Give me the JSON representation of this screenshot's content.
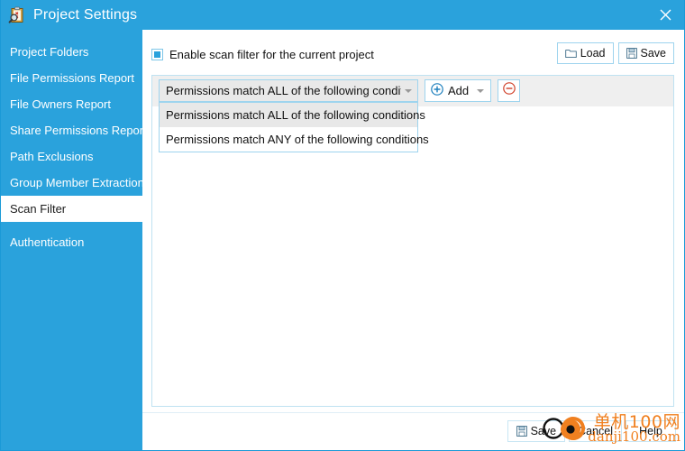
{
  "window": {
    "title": "Project Settings",
    "icon": "clipboard-search-icon",
    "close_label": "×",
    "accent_color": "#2aa2dc"
  },
  "sidebar": {
    "items": [
      {
        "label": "Project Folders",
        "selected": false
      },
      {
        "label": "File Permissions Report",
        "selected": false
      },
      {
        "label": "File Owners Report",
        "selected": false
      },
      {
        "label": "Share Permissions Report",
        "selected": false
      },
      {
        "label": "Path Exclusions",
        "selected": false
      },
      {
        "label": "Group Member Extraction",
        "selected": false
      },
      {
        "label": "Scan Filter",
        "selected": true
      },
      {
        "label": "Authentication",
        "selected": false
      }
    ]
  },
  "content": {
    "enable_checkbox": {
      "label": "Enable scan filter for the current project",
      "checked": true
    },
    "top_buttons": [
      {
        "label": "Load",
        "icon": "folder-icon"
      },
      {
        "label": "Save",
        "icon": "floppy-disk-icon"
      }
    ],
    "combo": {
      "value": "Permissions match ALL of the following conditions",
      "expanded": true,
      "options": [
        {
          "label": "Permissions match ALL of the following conditions",
          "highlighted": true
        },
        {
          "label": "Permissions match ANY of the following conditions",
          "highlighted": false
        }
      ]
    },
    "add_button": {
      "label": "Add",
      "icon": "plus-circle-icon"
    },
    "remove_button": {
      "label": "",
      "icon": "minus-circle-icon"
    }
  },
  "footer": {
    "buttons": [
      {
        "label": "Save",
        "icon": "floppy-disk-icon"
      },
      {
        "label": "Cancel",
        "icon": ""
      },
      {
        "label": "Help",
        "icon": ""
      }
    ]
  },
  "watermark": {
    "cn_text": "单机100网",
    "url_text": "danji100.com",
    "color": "#f08020"
  }
}
